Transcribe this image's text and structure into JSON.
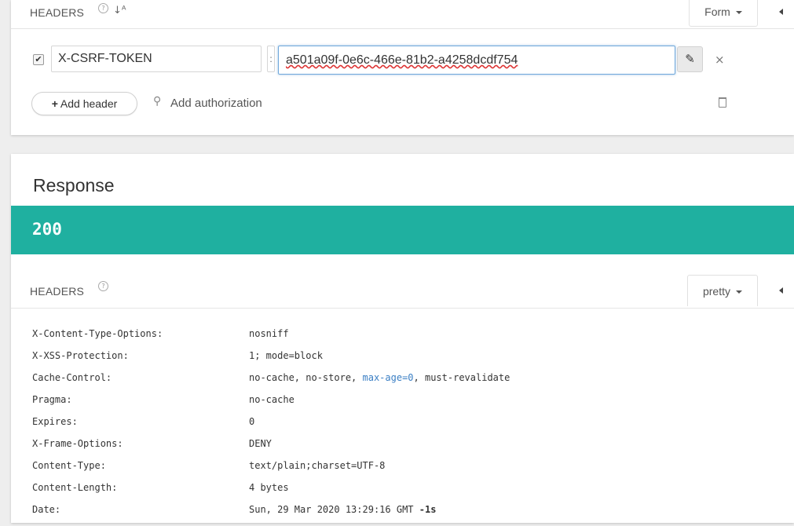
{
  "colors": {
    "status_bar": "#1fb0a0",
    "focus_border": "#6fa8dc",
    "highlight_text": "#3b7fc4"
  },
  "request": {
    "headers_title": "HEADERS",
    "help_icon": "?",
    "sort_icon": "sort-alpha-icon",
    "format_select": "Form",
    "header_row": {
      "enabled": true,
      "name": "X-CSRF-TOKEN",
      "separator": ":",
      "value": "a501a09f-0e6c-466e-81b2-a4258dcdf754"
    },
    "add_header_label": "Add header",
    "add_authorization_label": "Add authorization"
  },
  "response": {
    "title": "Response",
    "status_code": "200",
    "headers_title": "HEADERS",
    "format_select": "pretty",
    "headers": [
      {
        "key": "X-Content-Type-Options:",
        "value": "nosniff"
      },
      {
        "key": "X-XSS-Protection:",
        "value": "1; mode=block"
      },
      {
        "key": "Cache-Control:",
        "value_parts": [
          "no-cache, no-store, ",
          "max-age=0",
          ", must-revalidate"
        ]
      },
      {
        "key": "Pragma:",
        "value": "no-cache"
      },
      {
        "key": "Expires:",
        "value": "0"
      },
      {
        "key": "X-Frame-Options:",
        "value": "DENY"
      },
      {
        "key": "Content-Type:",
        "value": "text/plain;charset=UTF-8"
      },
      {
        "key": "Content-Length:",
        "value": "4 bytes"
      },
      {
        "key": "Date:",
        "value": "Sun, 29 Mar 2020 13:29:16 GMT",
        "extra": "-1s"
      }
    ]
  }
}
